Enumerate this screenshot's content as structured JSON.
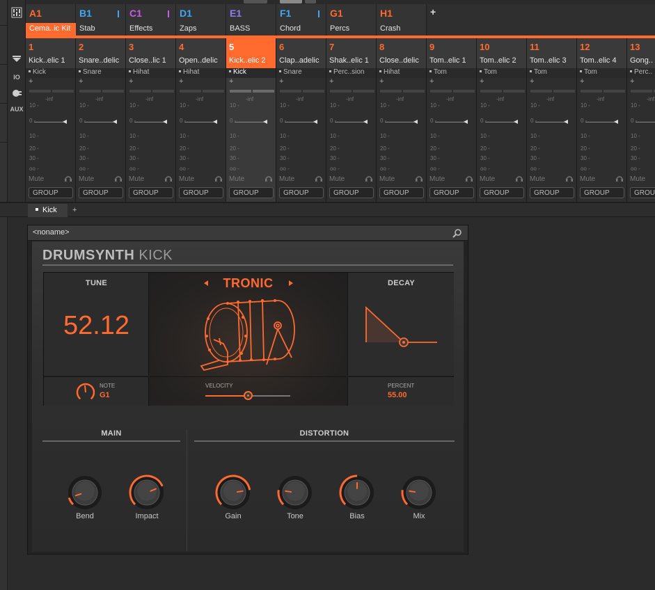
{
  "groups": [
    {
      "code": "A1",
      "name": "Cema..ic Kit",
      "color": "#ff6a2f",
      "selected": true,
      "mark": ""
    },
    {
      "code": "B1",
      "name": "Stab",
      "color": "#3fa9f5",
      "selected": false,
      "mark": "#3fa9f5"
    },
    {
      "code": "C1",
      "name": "Effects",
      "color": "#c65cf0",
      "selected": false,
      "mark": "#c65cf0"
    },
    {
      "code": "D1",
      "name": "Zaps",
      "color": "#3fa9f5",
      "selected": false,
      "mark": ""
    },
    {
      "code": "E1",
      "name": "BASS",
      "color": "#8f7cf5",
      "selected": false,
      "mark": ""
    },
    {
      "code": "F1",
      "name": "Chord",
      "color": "#3fa9f5",
      "selected": false,
      "mark": "#3fa9f5"
    },
    {
      "code": "G1",
      "name": "Percs",
      "color": "#ff6a2f",
      "selected": false,
      "mark": ""
    },
    {
      "code": "H1",
      "name": "Crash",
      "color": "#ff6a2f",
      "selected": false,
      "mark": ""
    }
  ],
  "group_add": "+",
  "side": {
    "io": "IO",
    "aux": "AUX"
  },
  "channels": [
    {
      "num": "1",
      "name": "Kick..elic 1",
      "sound": "Kick",
      "selected": false
    },
    {
      "num": "2",
      "name": "Snare..delic",
      "sound": "Snare",
      "selected": false
    },
    {
      "num": "3",
      "name": "Close..lic 1",
      "sound": "Hihat",
      "selected": false
    },
    {
      "num": "4",
      "name": "Open..delic",
      "sound": "Hihat",
      "selected": false
    },
    {
      "num": "5",
      "name": "Kick..elic 2",
      "sound": "Kick",
      "selected": true
    },
    {
      "num": "6",
      "name": "Clap..adelic",
      "sound": "Snare",
      "selected": false
    },
    {
      "num": "7",
      "name": "Shak..elic 1",
      "sound": "Perc..sion",
      "selected": false
    },
    {
      "num": "8",
      "name": "Close..delic",
      "sound": "Hihat",
      "selected": false
    },
    {
      "num": "9",
      "name": "Tom..elic 1",
      "sound": "Tom",
      "selected": false
    },
    {
      "num": "10",
      "name": "Tom..elic 2",
      "sound": "Tom",
      "selected": false
    },
    {
      "num": "11",
      "name": "Tom..elic 3",
      "sound": "Tom",
      "selected": false
    },
    {
      "num": "12",
      "name": "Tom..elic 4",
      "sound": "Tom",
      "selected": false
    },
    {
      "num": "13",
      "name": "Gong..",
      "sound": "Perc..",
      "selected": false
    }
  ],
  "channel_labels": {
    "add": "+",
    "inf": "-inf",
    "scale": [
      "10 -",
      "0 -",
      "10 -",
      "20 -",
      "30 -",
      "oo -"
    ],
    "mute": "Mute",
    "group": "GROUP"
  },
  "sound_tab": {
    "label": "Kick",
    "add": "+"
  },
  "plugin": {
    "preset_title": "<noname>",
    "brand_bold": "DRUMSYNTH",
    "brand_light": "KICK",
    "tune": {
      "label": "TUNE",
      "value": "52.12"
    },
    "note": {
      "label": "NOTE",
      "value": "G1"
    },
    "engine": {
      "name": "TRONIC"
    },
    "velocity": {
      "label": "VELOCITY",
      "level": 0.5
    },
    "decay": {
      "label": "DECAY"
    },
    "percent": {
      "label": "PERCENT",
      "value": "55.00"
    },
    "main_section": {
      "title": "MAIN",
      "knobs": [
        {
          "label": "Bend",
          "level": 0.1
        },
        {
          "label": "Impact",
          "level": 0.75
        }
      ]
    },
    "distortion_section": {
      "title": "DISTORTION",
      "knobs": [
        {
          "label": "Gain",
          "level": 0.8
        },
        {
          "label": "Tone",
          "level": 0.2
        },
        {
          "label": "Bias",
          "level": 0.5
        },
        {
          "label": "Mix",
          "level": 0.2
        }
      ]
    }
  },
  "colors": {
    "accent": "#ff6a2f"
  }
}
